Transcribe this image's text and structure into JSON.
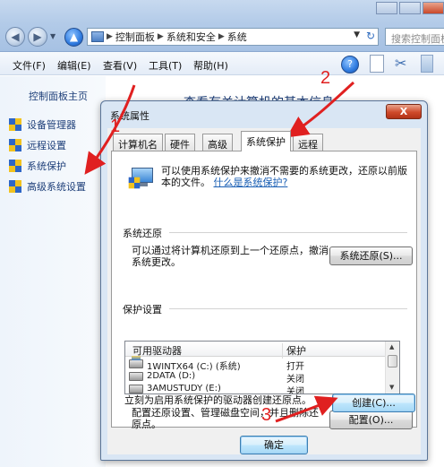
{
  "explorer": {
    "breadcrumb": [
      "控制面板",
      "系统和安全",
      "系统"
    ],
    "search_placeholder": "搜索控制面板",
    "menu": [
      "文件(F)",
      "编辑(E)",
      "查看(V)",
      "工具(T)",
      "帮助(H)"
    ],
    "left_pane": {
      "home": "控制面板主页",
      "links": [
        "设备管理器",
        "远程设置",
        "系统保护",
        "高级系统设置"
      ]
    },
    "content_heading": "查看有关计算机的基本信息"
  },
  "dialog": {
    "title": "系统属性",
    "close_label": "X",
    "tabs": [
      "计算机名",
      "硬件",
      "高级",
      "系统保护",
      "远程"
    ],
    "active_tab": "系统保护",
    "intro_text": "可以使用系统保护来撤消不需要的系统更改，还原以前版本的文件。",
    "intro_link": "什么是系统保护?",
    "restore_group": {
      "label": "系统还原",
      "text": "可以通过将计算机还原到上一个还原点，撤消系统更改。",
      "button": "系统还原(S)..."
    },
    "protection_group": {
      "label": "保护设置",
      "columns": [
        "可用驱动器",
        "保护"
      ],
      "drives": [
        {
          "name": "1WINTX64 (C:) (系统)",
          "status": "打开"
        },
        {
          "name": "2DATA (D:)",
          "status": "关闭"
        },
        {
          "name": "3AMUSTUDY (E:)",
          "status": "关闭"
        }
      ],
      "configure_text": "配置还原设置、管理磁盘空间，并且删除还原点。",
      "configure_button": "配置(O)...",
      "create_text": "立刻为启用系统保护的驱动器创建还原点。",
      "create_button": "创建(C)..."
    },
    "ok_button": "确定"
  },
  "annotations": {
    "color": "#e02020",
    "labels": [
      "1",
      "2",
      "3"
    ]
  }
}
